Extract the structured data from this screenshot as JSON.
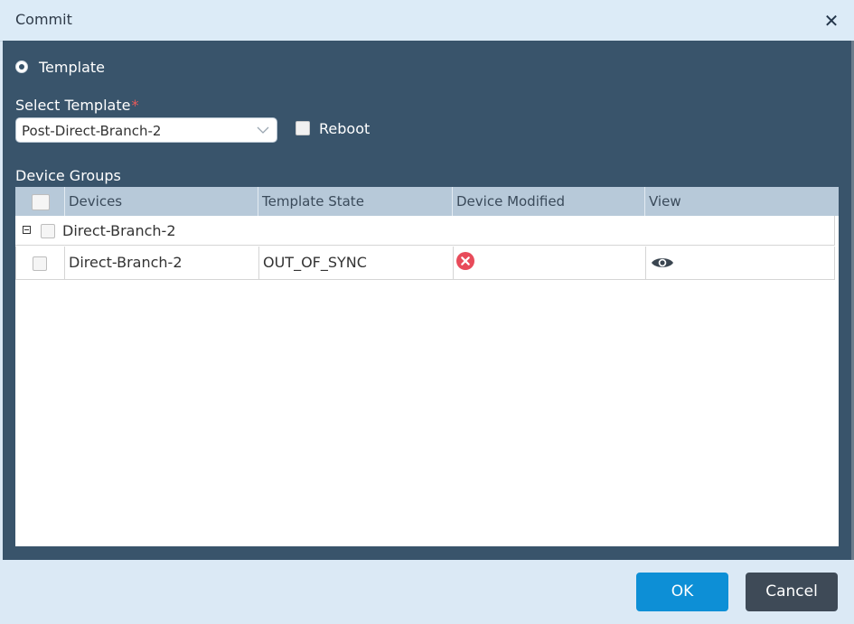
{
  "dialog": {
    "title": "Commit"
  },
  "mode": {
    "radio_label": "Template"
  },
  "template_select": {
    "label": "Select Template",
    "required_mark": "*",
    "value": "Post-Direct-Branch-2"
  },
  "reboot": {
    "label": "Reboot"
  },
  "device_groups": {
    "label": "Device Groups",
    "columns": [
      "Devices",
      "Template State",
      "Device Modified",
      "View"
    ],
    "group": {
      "name": "Direct-Branch-2"
    },
    "rows": [
      {
        "device": "Direct-Branch-2",
        "template_state": "OUT_OF_SYNC",
        "device_modified_icon": "error-x-icon",
        "view_icon": "eye-icon"
      }
    ]
  },
  "footer": {
    "ok_label": "OK",
    "cancel_label": "Cancel"
  },
  "colors": {
    "panel_bg": "#39546b",
    "header_bg": "#b7c9d9",
    "ok_button": "#0d8fd6",
    "cancel_button": "#3e4a57",
    "error_icon": "#e84b5a"
  }
}
